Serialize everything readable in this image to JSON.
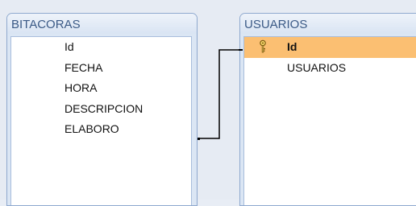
{
  "tables": [
    {
      "title": "BITACORAS",
      "fields": [
        {
          "label": "Id"
        },
        {
          "label": "FECHA"
        },
        {
          "label": "HORA"
        },
        {
          "label": "DESCRIPCION"
        },
        {
          "label": "ELABORO"
        }
      ]
    },
    {
      "title": "USUARIOS",
      "fields": [
        {
          "label": "Id",
          "primary_key": true,
          "selected": true
        },
        {
          "label": "USUARIOS"
        }
      ]
    }
  ],
  "relationship": {
    "from": "BITACORAS.ELABORO",
    "to": "USUARIOS.Id"
  },
  "colors": {
    "selected_row": "#fbbf72",
    "title_text": "#3b5a86",
    "window_border": "#8fa9cf"
  },
  "icons": {
    "primary_key": "key-icon"
  }
}
